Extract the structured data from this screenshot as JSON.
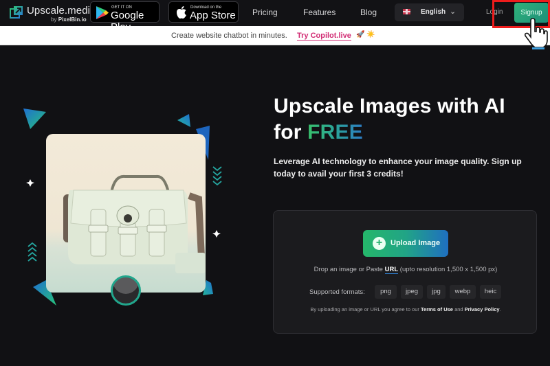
{
  "nav": {
    "logo": {
      "title": "Upscale.media",
      "subtitle_prefix": "by",
      "subtitle_brand": "PixelBin.io"
    },
    "google_play": {
      "small": "GET IT ON",
      "big": "Google Play"
    },
    "app_store": {
      "small": "Download on the",
      "big": "App Store"
    },
    "links": [
      "Pricing",
      "Features",
      "Blog"
    ],
    "language": {
      "selected": "English"
    },
    "login_label": "Login",
    "signup_label": "Signup"
  },
  "banner": {
    "text": "Create website chatbot in minutes.",
    "link_label": "Try Copilot.live",
    "emoji": "🚀 ☀️"
  },
  "hero": {
    "title_line1": "Upscale Images with AI",
    "title_prefix": "for ",
    "title_highlight": "FREE",
    "subtitle": "Leverage AI technology to enhance your image quality. Sign up today to avail your first 3 credits!"
  },
  "upload": {
    "button_label": "Upload Image",
    "drop_prefix": "Drop an image or Paste ",
    "drop_link": "URL",
    "drop_suffix": " (upto resolution 1,500 x 1,500 px)",
    "formats_label": "Supported formats:",
    "formats": [
      "png",
      "jpeg",
      "jpg",
      "webp",
      "heic"
    ],
    "terms_prefix": "By uploading an image or URL you agree to our ",
    "terms_link": "Terms of Use",
    "terms_and": " and ",
    "privacy_link": "Privacy Policy",
    "terms_suffix": "."
  },
  "colors": {
    "accent_green": "#2fb37a",
    "accent_blue": "#1f6fc0",
    "banner_link": "#d12a73",
    "highlight_box": "#ee1c1c"
  }
}
